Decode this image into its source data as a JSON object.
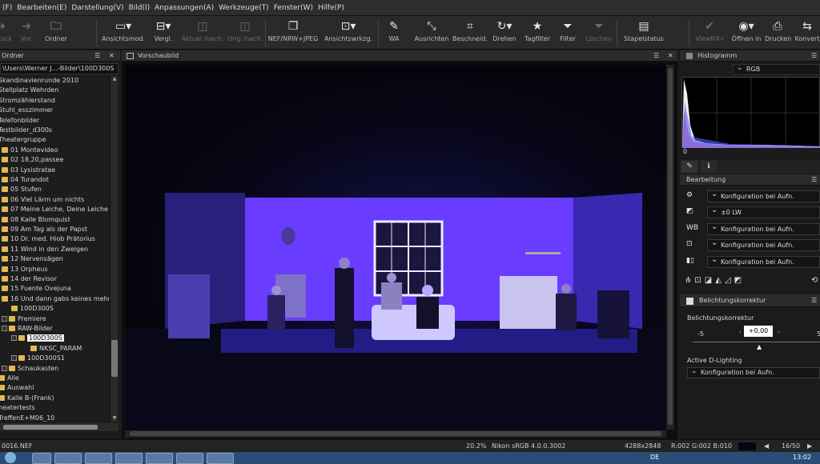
{
  "menu": [
    "(F)",
    "Bearbeiten(E)",
    "Darstellung(V)",
    "Bild(I)",
    "Anpassungen(A)",
    "Werkzeuge(T)",
    "Fenster(W)",
    "Hilfe(P)"
  ],
  "toolbar": {
    "back": "Zurück",
    "forward": "Vor.",
    "folder": "Ordner",
    "view_mode": "Ansichtsmod.",
    "compare": "Vergl.",
    "current_after": "Aktuel./nach.",
    "orig_after": "Orig./nach.",
    "nef_jpeg": "NEF/NRW+JPEG",
    "view_tool": "Ansichtswrkzg.",
    "wb": "WA",
    "straighten": "Ausrichten",
    "crop": "Beschneid.",
    "rotate": "Drehen",
    "tag_filter": "Tagfilter",
    "filter": "Filter",
    "delete": "Löschen",
    "batch": "Stapelstatus",
    "viewnx": "ViewNX-i",
    "open_in": "Öffnen in",
    "print": "Drucken",
    "convert": "Konvert"
  },
  "folder_panel": {
    "title": "Ordner",
    "path": "\\Users\\Werner J...-Bilder\\100D300S",
    "items": [
      {
        "label": "Skandinavienrunde 2010",
        "level": 0,
        "folder": false
      },
      {
        "label": "Stellplatz Wehrden",
        "level": 0,
        "folder": false
      },
      {
        "label": "Stromzählerstand",
        "level": 0,
        "folder": false
      },
      {
        "label": "Stuhl_esszimmer",
        "level": 0,
        "folder": false
      },
      {
        "label": "Telefonbilder",
        "level": 0,
        "folder": false
      },
      {
        "label": "Testbilder_d300s",
        "level": 0,
        "folder": false
      },
      {
        "label": "Theatergruppe",
        "level": 0,
        "folder": false
      },
      {
        "label": "01 Montevideo",
        "level": 1,
        "folder": true
      },
      {
        "label": "02 18,20,passee",
        "level": 1,
        "folder": true
      },
      {
        "label": "03 Lysistratae",
        "level": 1,
        "folder": true
      },
      {
        "label": "04 Turandot",
        "level": 1,
        "folder": true
      },
      {
        "label": "05 Stufen",
        "level": 1,
        "folder": true
      },
      {
        "label": "06 Viel Lärm um nichts",
        "level": 1,
        "folder": true
      },
      {
        "label": "07 Meine Leiche, Deine Leiche",
        "level": 1,
        "folder": true
      },
      {
        "label": "08 Kalle Blomquist",
        "level": 1,
        "folder": true
      },
      {
        "label": "09 Am Tag als der Papst",
        "level": 1,
        "folder": true
      },
      {
        "label": "10 Dr. med. Hiob Prätorius",
        "level": 1,
        "folder": true
      },
      {
        "label": "11 Wind in den Zweigen",
        "level": 1,
        "folder": true
      },
      {
        "label": "12 Nervensägen",
        "level": 1,
        "folder": true
      },
      {
        "label": "13 Orpheus",
        "level": 1,
        "folder": true
      },
      {
        "label": "14 der Revisor",
        "level": 1,
        "folder": true
      },
      {
        "label": "15 Fuente Ovejuna",
        "level": 1,
        "folder": true
      },
      {
        "label": "16 Und dann gabs keines mehr",
        "level": 1,
        "folder": true
      },
      {
        "label": "100D300S",
        "level": 2,
        "folder": true
      },
      {
        "label": "Premiere",
        "level": 1,
        "folder": true,
        "expander": true
      },
      {
        "label": "RAW-Bilder",
        "level": 1,
        "folder": true,
        "expander": true
      },
      {
        "label": "100D300S",
        "level": 2,
        "folder": true,
        "expander": true,
        "selected": true
      },
      {
        "label": "NKSC_PARAM",
        "level": 3,
        "folder": true
      },
      {
        "label": "100D300S1",
        "level": 2,
        "folder": true,
        "expander": true
      },
      {
        "label": "Schaukasten",
        "level": 1,
        "folder": true,
        "expander": true
      },
      {
        "label": "Alle",
        "level": 0,
        "folder": true
      },
      {
        "label": "Auswahl",
        "level": 0,
        "folder": true
      },
      {
        "label": "Kalle B-(Frank)",
        "level": 0,
        "folder": true
      },
      {
        "label": "heatertests",
        "level": 0,
        "folder": false
      },
      {
        "label": "TreffenE+M06_10",
        "level": 0,
        "folder": false
      }
    ]
  },
  "preview": {
    "title": "Vorschaubild"
  },
  "histogram": {
    "title": "Histogramm",
    "channel": "RGB",
    "axis_min": "0"
  },
  "edit_panel": {
    "title": "Bearbeitung",
    "rows": [
      {
        "icon": "gear-icon",
        "value": "Konfiguration bei Aufn."
      },
      {
        "icon": "exposure-icon",
        "value": "±0 LW"
      },
      {
        "icon": "white-balance-icon",
        "value": "Konfiguration bei Aufn."
      },
      {
        "icon": "picture-control-icon",
        "value": "Konfiguration bei Aufn."
      },
      {
        "icon": "dlighting-icon",
        "value": "Konfiguration bei Aufn."
      }
    ]
  },
  "exposure_panel": {
    "title": "Belichtungskorrektur",
    "label": "Belichtungskorrektur",
    "value": "+0,00",
    "min": "-5",
    "max": "5",
    "adl_label": "Active D-Lighting",
    "adl_value": "Konfiguration bei Aufn."
  },
  "statusbar": {
    "filename": "0016.NEF",
    "zoom": "20.2%",
    "profile": "Nikon sRGB 4.0.0.3002",
    "dimensions": "4288x2848",
    "rgb": "R:002 G:002 B:010",
    "counter": "16/50"
  },
  "taskbar": {
    "lang": "DE",
    "time": "13:02"
  },
  "colors": {
    "accent": "#e3b94e",
    "stage": "#3a24c8",
    "wall": "#6a3cff"
  }
}
